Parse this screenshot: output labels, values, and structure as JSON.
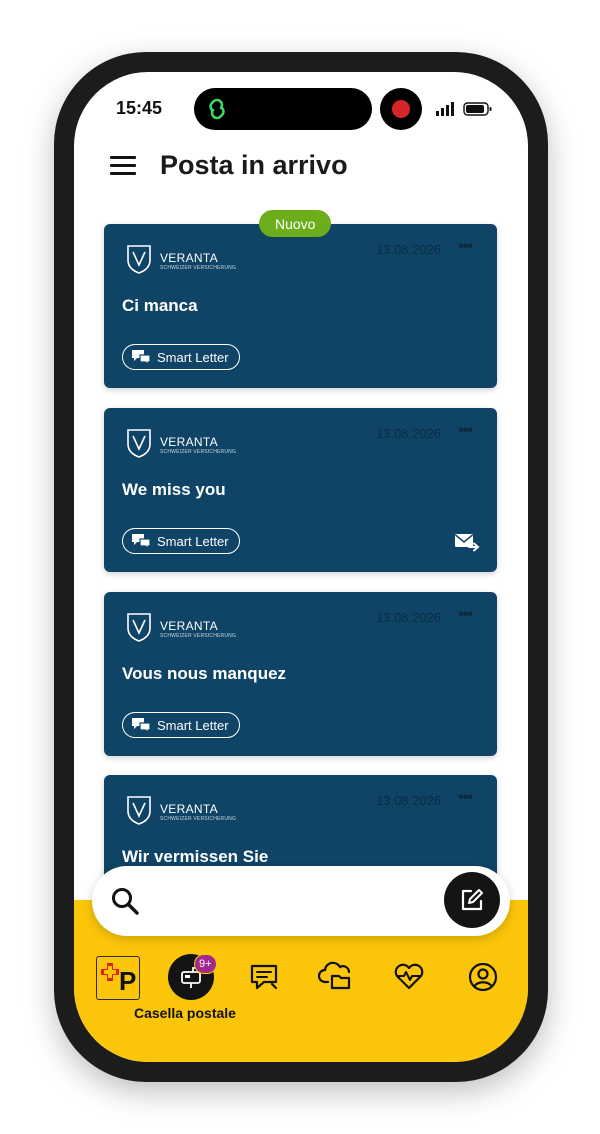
{
  "status_bar": {
    "time": "15:45"
  },
  "header": {
    "title": "Posta in arrivo"
  },
  "new_badge": "Nuovo",
  "cards": [
    {
      "brand": "VERANTA",
      "brand_sub": "SCHWEIZER VERSICHERUNG",
      "date": "13.08.2026",
      "subject": "Ci manca",
      "chip": "Smart Letter",
      "forwarded": false
    },
    {
      "brand": "VERANTA",
      "brand_sub": "SCHWEIZER VERSICHERUNG",
      "date": "13.08.2026",
      "subject": "We miss you",
      "chip": "Smart Letter",
      "forwarded": true
    },
    {
      "brand": "VERANTA",
      "brand_sub": "SCHWEIZER VERSICHERUNG",
      "date": "13.08.2026",
      "subject": "Vous nous manquez",
      "chip": "Smart Letter",
      "forwarded": false
    },
    {
      "brand": "VERANTA",
      "brand_sub": "SCHWEIZER VERSICHERUNG",
      "date": "13.08.2026",
      "subject": "Wir vermissen Sie",
      "chip": "",
      "forwarded": false
    }
  ],
  "bottom_nav": {
    "active_label": "Casella postale",
    "mailbox_badge": "9+",
    "items": [
      "post-logo",
      "mailbox-icon",
      "messages-icon",
      "cloud-folder-icon",
      "health-heart-icon",
      "profile-icon"
    ]
  },
  "colors": {
    "card_bg": "#0f4466",
    "accent_yellow": "#fbc50a",
    "new_badge": "#6cad1c",
    "badge": "#a02a8c"
  }
}
